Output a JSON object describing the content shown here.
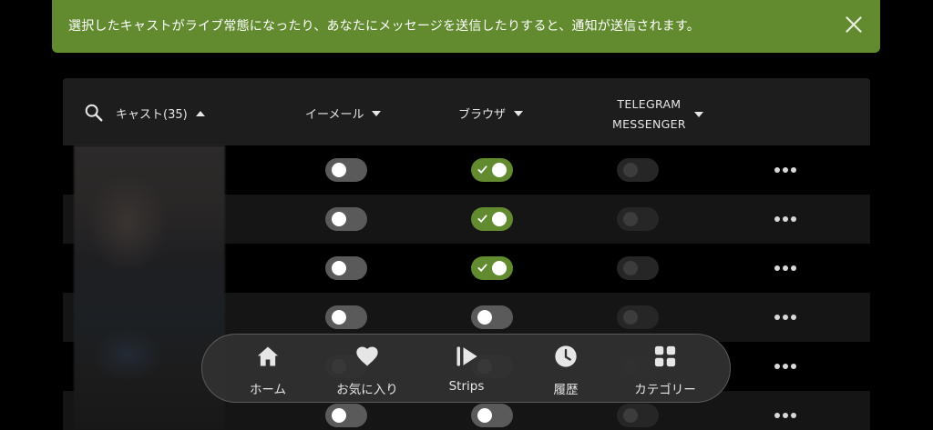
{
  "banner": {
    "text": "選択したキャストがライブ常態になったり、あなたにメッセージを送信したりすると、通知が送信されます。",
    "close_icon": "close-icon"
  },
  "table": {
    "headers": {
      "cast": "キャスト(35)",
      "email": "イーメール",
      "browser": "ブラウザ",
      "telegram_line1": "TELEGRAM",
      "telegram_line2": "MESSENGER"
    },
    "rows": [
      {
        "email": "off",
        "browser": "on",
        "telegram": "disabled"
      },
      {
        "email": "off",
        "browser": "on",
        "telegram": "disabled"
      },
      {
        "email": "off",
        "browser": "on",
        "telegram": "disabled"
      },
      {
        "email": "off",
        "browser": "off",
        "telegram": "disabled"
      },
      {
        "email": "off",
        "browser": "off",
        "telegram": "disabled"
      },
      {
        "email": "off",
        "browser": "off",
        "telegram": "disabled"
      }
    ]
  },
  "bottom_nav": {
    "items": [
      {
        "label": "ホーム",
        "icon": "home-icon"
      },
      {
        "label": "お気に入り",
        "icon": "heart-icon"
      },
      {
        "label": "Strips",
        "icon": "strips-play-icon"
      },
      {
        "label": "履歴",
        "icon": "clock-icon"
      },
      {
        "label": "カテゴリー",
        "icon": "grid-icon"
      }
    ]
  },
  "colors": {
    "accent": "#628a2f",
    "background": "#000000",
    "header_bg": "#1d1d1d",
    "row_alt_bg": "#151515"
  }
}
